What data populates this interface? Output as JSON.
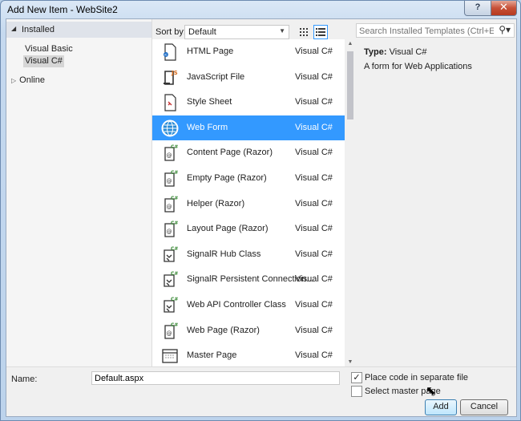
{
  "window": {
    "title": "Add New Item - WebSite2",
    "help_label": "?",
    "close_label": "✕"
  },
  "left_pane": {
    "installed_label": "Installed",
    "items": [
      {
        "label": "Visual Basic"
      },
      {
        "label": "Visual C#"
      }
    ],
    "online_label": "Online"
  },
  "toolbar": {
    "sort_label": "Sort by:",
    "sort_value": "Default"
  },
  "search": {
    "placeholder": "Search Installed Templates (Ctrl+E)"
  },
  "templates": [
    {
      "name": "HTML Page",
      "lang": "Visual C#",
      "icon": "html-page-icon"
    },
    {
      "name": "JavaScript File",
      "lang": "Visual C#",
      "icon": "javascript-file-icon"
    },
    {
      "name": "Style Sheet",
      "lang": "Visual C#",
      "icon": "style-sheet-icon"
    },
    {
      "name": "Web Form",
      "lang": "Visual C#",
      "icon": "web-form-icon"
    },
    {
      "name": "Content Page (Razor)",
      "lang": "Visual C#",
      "icon": "razor-page-icon"
    },
    {
      "name": "Empty Page (Razor)",
      "lang": "Visual C#",
      "icon": "razor-page-icon"
    },
    {
      "name": "Helper (Razor)",
      "lang": "Visual C#",
      "icon": "razor-page-icon"
    },
    {
      "name": "Layout Page (Razor)",
      "lang": "Visual C#",
      "icon": "razor-page-icon"
    },
    {
      "name": "SignalR Hub Class",
      "lang": "Visual C#",
      "icon": "signalr-icon"
    },
    {
      "name": "SignalR Persistent Connection...",
      "lang": "Visual C#",
      "icon": "signalr-icon"
    },
    {
      "name": "Web API Controller Class",
      "lang": "Visual C#",
      "icon": "signalr-icon"
    },
    {
      "name": "Web Page (Razor)",
      "lang": "Visual C#",
      "icon": "razor-page-icon"
    },
    {
      "name": "Master Page",
      "lang": "Visual C#",
      "icon": "master-page-icon"
    }
  ],
  "info": {
    "type_label": "Type:",
    "type_value": "Visual C#",
    "description": "A form for Web Applications"
  },
  "bottom": {
    "name_label": "Name:",
    "name_value": "Default.aspx",
    "place_code_label": "Place code in separate file",
    "place_code_checked": "✓",
    "select_master_label": "Select master page",
    "add_label": "Add",
    "cancel_label": "Cancel"
  },
  "colors": {
    "selection": "#3399ff",
    "accent": "#3c7fb1"
  }
}
